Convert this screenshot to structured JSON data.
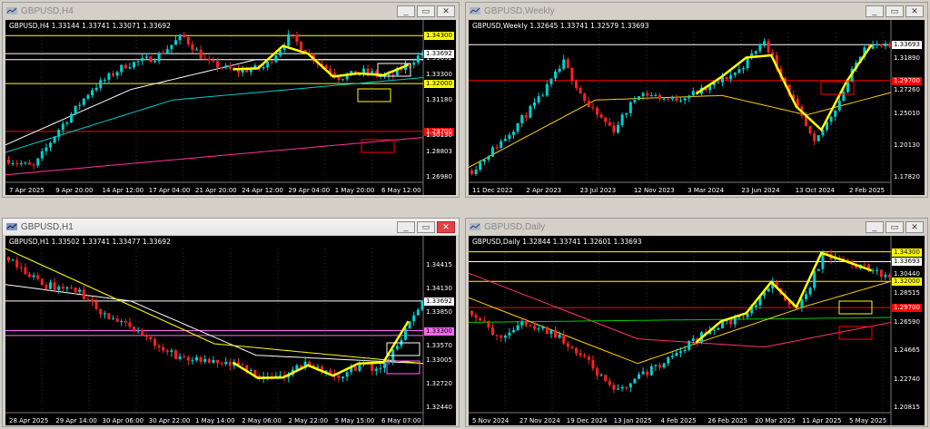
{
  "windows": [
    {
      "id": "h4",
      "title": "GBPUSD,H4",
      "active": false,
      "ohlc": "GBPUSD,H4  1.33144 1.33741 1.33071 1.33692",
      "xlabels": [
        "7 Apr 2025",
        "9 Apr 20:00",
        "14 Apr 12:00",
        "17 Apr 04:00",
        "21 Apr 20:00",
        "24 Apr 12:00",
        "29 Apr 04:00",
        "1 May 20:00",
        "6 May 12:00"
      ],
      "ylabels": [
        "1.33692",
        "1.33300",
        "1.31180",
        "1.30130",
        "1.28803",
        "1.26980"
      ],
      "tags": [
        {
          "text": "1.34300",
          "bg": "#ffff00",
          "fg": "#000000"
        },
        {
          "text": "1.33692",
          "bg": "#ffffff",
          "fg": "#000000"
        },
        {
          "text": "1.32000",
          "bg": "#ffff00",
          "fg": "#000000"
        },
        {
          "text": "1.29700",
          "bg": "#ff0000",
          "fg": "#ffffff"
        }
      ]
    },
    {
      "id": "weekly",
      "title": "GBPUSD,Weekly",
      "active": false,
      "ohlc": "GBPUSD,Weekly  1.32645 1.33741 1.32579 1.33693",
      "xlabels": [
        "11 Dec 2022",
        "2 Apr 2023",
        "23 Jul 2023",
        "12 Nov 2023",
        "3 Mar 2024",
        "23 Jun 2024",
        "13 Oct 2024",
        "2 Feb 2025"
      ],
      "ylabels": [
        "1.31890",
        "1.27260",
        "1.25010",
        "1.20130",
        "1.17820"
      ],
      "tags": [
        {
          "text": "1.33693",
          "bg": "#ffffff",
          "fg": "#000000"
        },
        {
          "text": "1.29700",
          "bg": "#ff0000",
          "fg": "#ffffff"
        }
      ]
    },
    {
      "id": "h1",
      "title": "GBPUSD,H1",
      "active": true,
      "ohlc": "GBPUSD,H1  1.33502 1.33741 1.33477 1.33692",
      "xlabels": [
        "28 Apr 2025",
        "29 Apr 14:00",
        "30 Apr 06:00",
        "30 Apr 22:00",
        "1 May 14:00",
        "2 May 06:00",
        "2 May 22:00",
        "5 May 15:00",
        "6 May 07:00"
      ],
      "ylabels": [
        "1.34415",
        "1.34130",
        "1.33850",
        "1.33570",
        "1.33005",
        "1.32720",
        "1.32440"
      ],
      "tags": [
        {
          "text": "1.33692",
          "bg": "#ffffff",
          "fg": "#000000"
        },
        {
          "text": "1.33300",
          "bg": "#ff66ff",
          "fg": "#000000"
        }
      ]
    },
    {
      "id": "daily",
      "title": "GBPUSD,Daily",
      "active": false,
      "ohlc": "GBPUSD,Daily  1.32844 1.33741 1.32601 1.33693",
      "xlabels": [
        "5 Nov 2024",
        "27 Nov 2024",
        "19 Dec 2024",
        "13 Jan 2025",
        "4 Feb 2025",
        "26 Feb 2025",
        "20 Mar 2025",
        "11 Apr 2025",
        "5 May 2025"
      ],
      "ylabels": [
        "1.30440",
        "1.28515",
        "1.26590",
        "1.24665",
        "1.22740",
        "1.20815"
      ],
      "tags": [
        {
          "text": "1.34300",
          "bg": "#ffff00",
          "fg": "#000000"
        },
        {
          "text": "1.33693",
          "bg": "#ffffff",
          "fg": "#000000"
        },
        {
          "text": "1.32000",
          "bg": "#ffff00",
          "fg": "#000000"
        },
        {
          "text": "1.29700",
          "bg": "#ff0000",
          "fg": "#ffffff"
        }
      ]
    }
  ],
  "buttons": {
    "minimize": "_",
    "restore": "▭",
    "close": "✕"
  }
}
